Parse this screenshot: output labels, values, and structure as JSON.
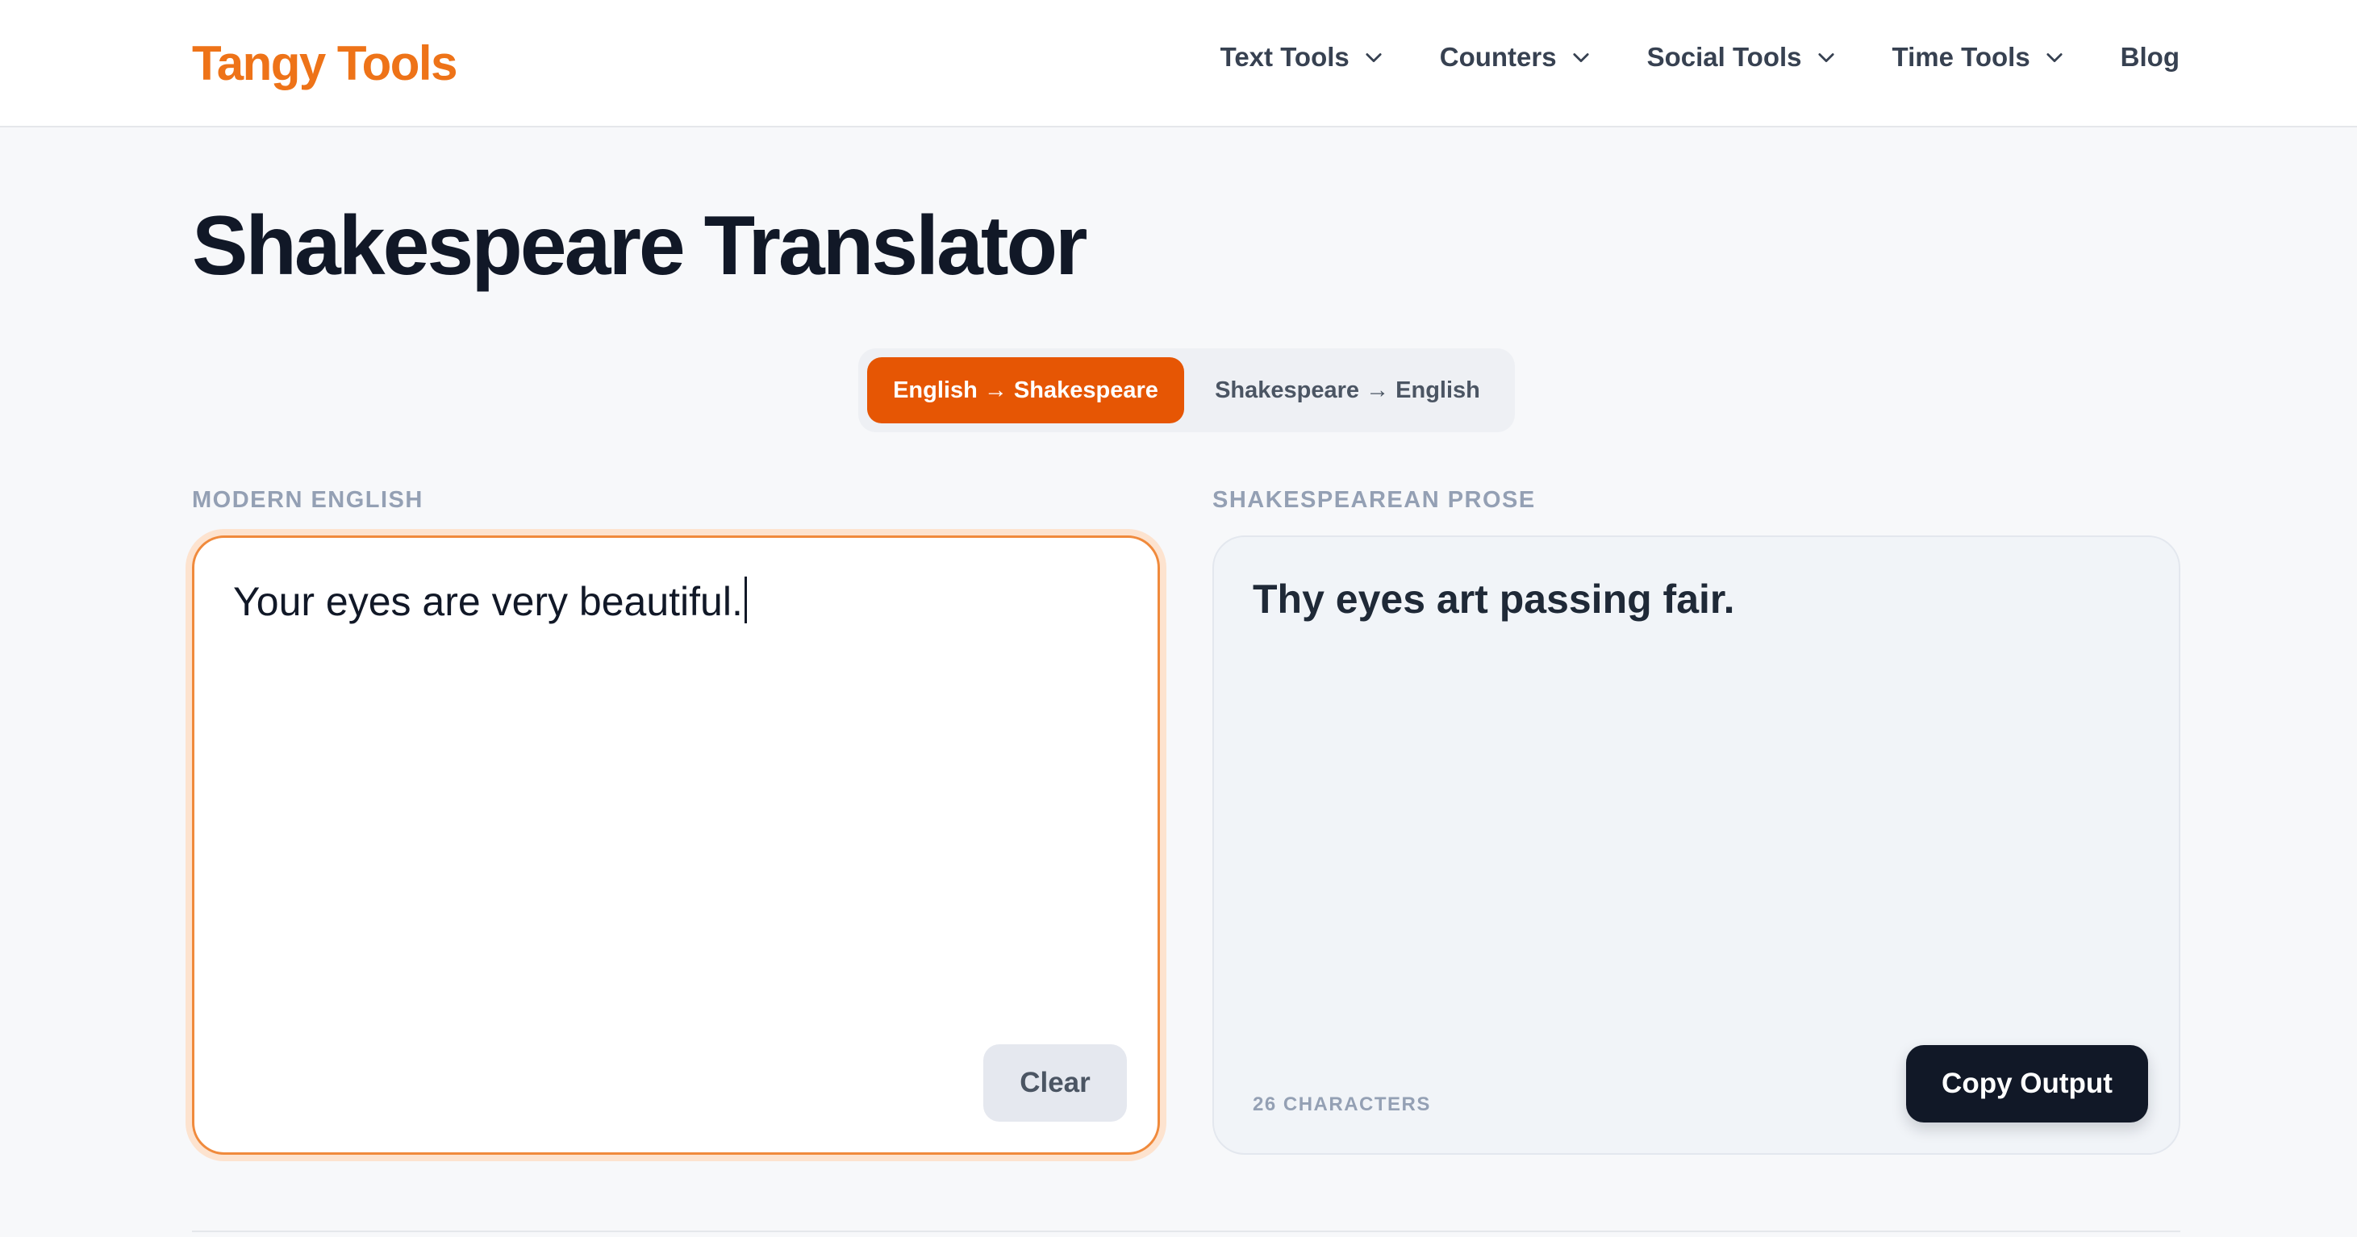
{
  "header": {
    "logo": "Tangy Tools",
    "nav": [
      {
        "label": "Text Tools",
        "has_dropdown": true
      },
      {
        "label": "Counters",
        "has_dropdown": true
      },
      {
        "label": "Social Tools",
        "has_dropdown": true
      },
      {
        "label": "Time Tools",
        "has_dropdown": true
      },
      {
        "label": "Blog",
        "has_dropdown": false
      }
    ]
  },
  "page": {
    "title": "Shakespeare Translator"
  },
  "mode_toggle": {
    "options": [
      {
        "label": "English → Shakespeare",
        "active": true
      },
      {
        "label": "Shakespeare → English",
        "active": false
      }
    ]
  },
  "input_panel": {
    "label": "MODERN ENGLISH",
    "value": "Your eyes are very beautiful.",
    "clear_label": "Clear"
  },
  "output_panel": {
    "label": "SHAKESPEAREAN PROSE",
    "value": "Thy eyes art passing fair.",
    "char_count": "26 CHARACTERS",
    "copy_label": "Copy Output"
  },
  "colors": {
    "brand": "#ee7318",
    "accent": "#e65604",
    "dark_button": "#111827"
  },
  "icons": {
    "nav_dropdown": "chevron-down-icon"
  }
}
